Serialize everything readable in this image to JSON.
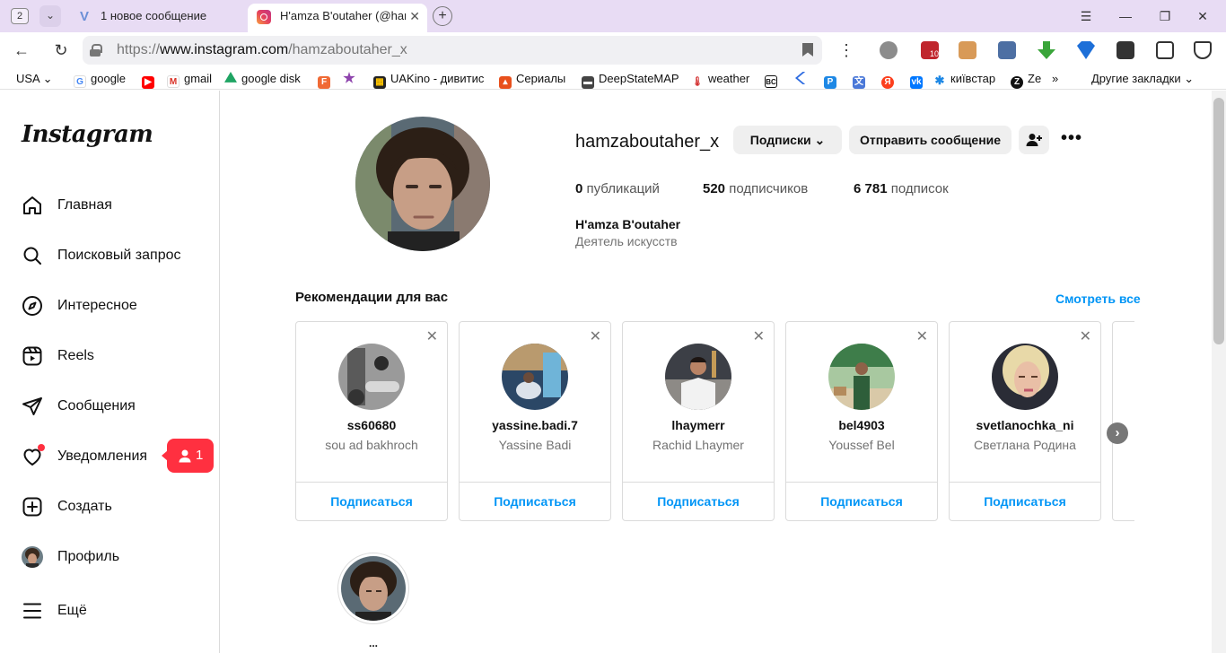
{
  "browser": {
    "tab_count": "2",
    "tabs": [
      {
        "label": "1 новое сообщение"
      },
      {
        "label": "H'amza B'outaher (@hamzaboutaher_x)"
      }
    ],
    "address": {
      "prefix": "https://",
      "host": "www.instagram.com",
      "path": "/hamzaboutaher_x"
    },
    "bookmarks": [
      {
        "label": "USA"
      },
      {
        "label": "google"
      },
      {
        "label": "gmail"
      },
      {
        "label": "google disk"
      },
      {
        "label": "UAKino - дивитис"
      },
      {
        "label": "Сериалы"
      },
      {
        "label": "DeepStateMAP"
      },
      {
        "label": "weather"
      },
      {
        "label": "київстар"
      },
      {
        "label": "Ze"
      }
    ],
    "other_bookmarks": "Другие закладки",
    "ext_badge": "10"
  },
  "sidebar": {
    "logo": "Instagram",
    "items": [
      {
        "label": "Главная",
        "icon": "home-icon"
      },
      {
        "label": "Поисковый запрос",
        "icon": "search-icon"
      },
      {
        "label": "Интересное",
        "icon": "compass-icon"
      },
      {
        "label": "Reels",
        "icon": "reels-icon"
      },
      {
        "label": "Сообщения",
        "icon": "send-icon"
      },
      {
        "label": "Уведомления",
        "icon": "heart-icon"
      },
      {
        "label": "Создать",
        "icon": "plus-square-icon"
      },
      {
        "label": "Профиль",
        "icon": "avatar"
      },
      {
        "label": "Ещё",
        "icon": "menu-icon"
      }
    ],
    "notification_popover": {
      "count": "1"
    }
  },
  "profile": {
    "username": "hamzaboutaher_x",
    "following_button": "Подписки",
    "message_button": "Отправить сообщение",
    "stats": [
      {
        "value": "0",
        "label": "публикаций"
      },
      {
        "value": "520",
        "label": "подписчиков"
      },
      {
        "value": "6 781",
        "label": "подписок"
      }
    ],
    "full_name": "H'amza B'outaher",
    "category": "Деятель искусств"
  },
  "recommendations": {
    "title": "Рекомендации для вас",
    "see_all": "Смотреть все",
    "follow_label": "Подписаться",
    "cards": [
      {
        "username": "ss60680",
        "name": "sou ad bakhroch"
      },
      {
        "username": "yassine.badi.7",
        "name": "Yassine Badi"
      },
      {
        "username": "lhaymerr",
        "name": "Rachid Lhaymer"
      },
      {
        "username": "bel4903",
        "name": "Youssef Bel"
      },
      {
        "username": "svetlanochka_ni",
        "name": "Светлана Родина"
      }
    ]
  },
  "highlight": {
    "label": "..."
  }
}
